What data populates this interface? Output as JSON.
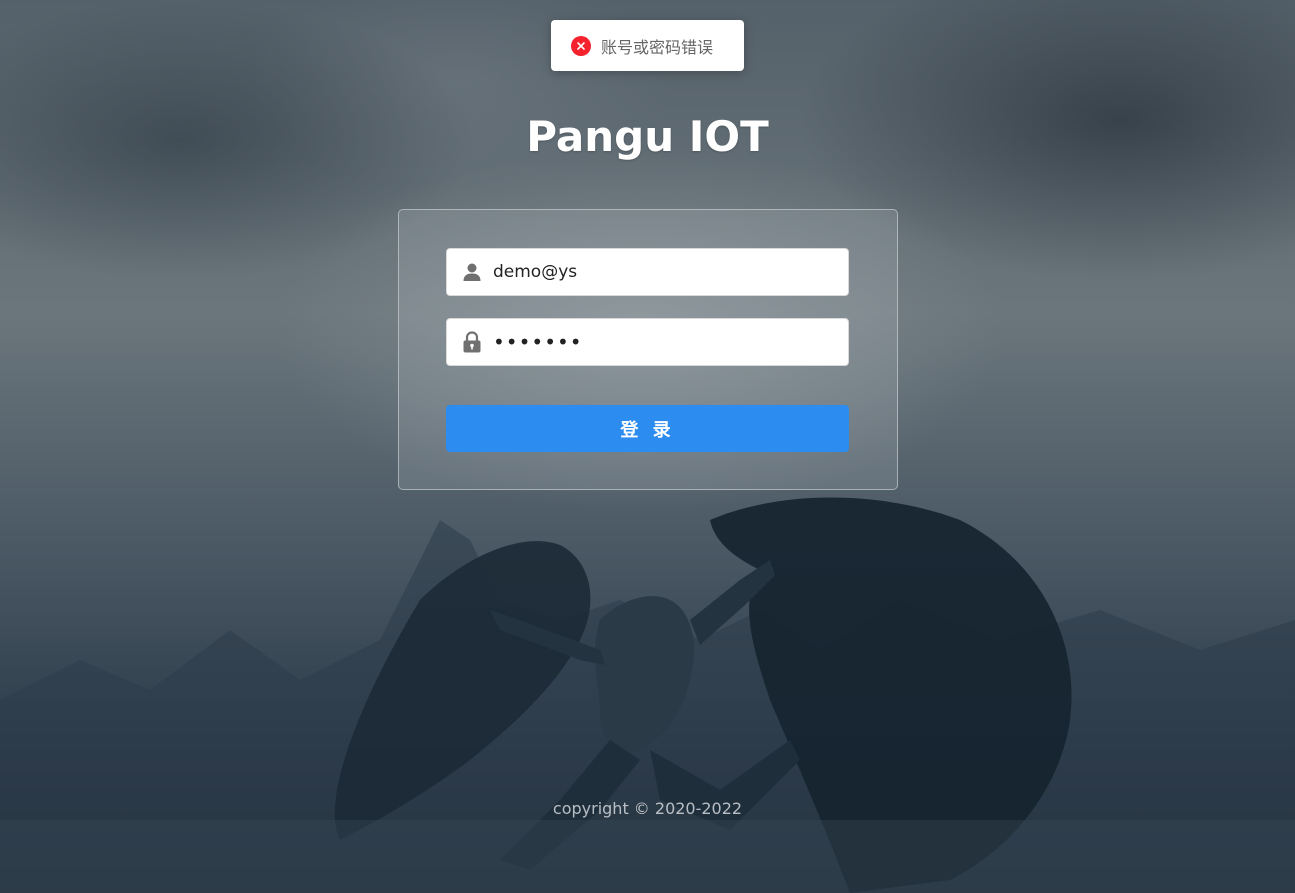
{
  "toast": {
    "icon": "error-icon",
    "message": "账号或密码错误",
    "color": "#f5222d"
  },
  "app": {
    "title": "Pangu IOT"
  },
  "login_form": {
    "username": {
      "icon": "user-icon",
      "value": "demo@ys"
    },
    "password": {
      "icon": "lock-icon",
      "value": "•••••••"
    },
    "submit_label": "登 录",
    "accent_color": "#2d8cf0"
  },
  "footer": {
    "copyright": "copyright © 2020-2022"
  }
}
